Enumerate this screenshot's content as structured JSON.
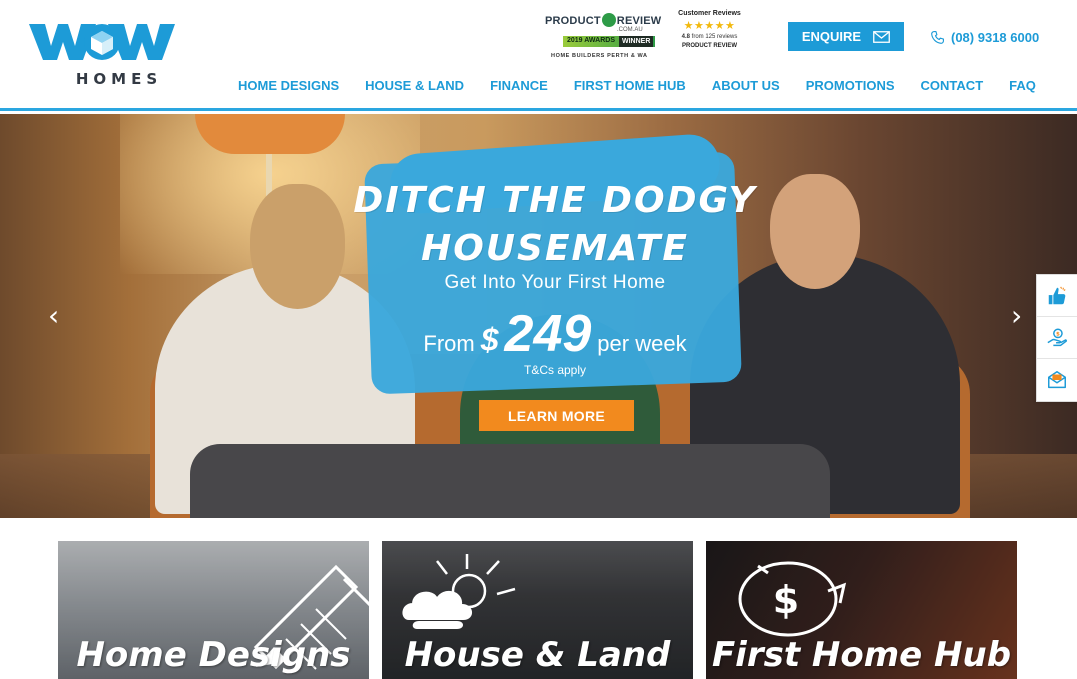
{
  "brand": {
    "logo_text": "WOW",
    "logo_subtext": "HOMES",
    "accent": "#1d9bd7",
    "orange": "#f28a1e"
  },
  "awards": {
    "product_review": {
      "title_left": "PRODUCT",
      "title_right": "REVIEW",
      "domain": ".COM.AU",
      "band_left": "2019 AWARDS",
      "band_right": "WINNER",
      "footer": "HOME BUILDERS PERTH & WA"
    },
    "customer_reviews": {
      "title": "Customer Reviews",
      "stars": "★★★★★",
      "rating": "4.8",
      "rating_suffix": "from 125 reviews",
      "footer": "PRODUCT REVIEW"
    }
  },
  "header": {
    "enquire_label": "ENQUIRE",
    "phone": "(08) 9318 6000"
  },
  "nav": {
    "items": [
      {
        "label": "HOME DESIGNS"
      },
      {
        "label": "HOUSE & LAND"
      },
      {
        "label": "FINANCE"
      },
      {
        "label": "FIRST HOME HUB"
      },
      {
        "label": "ABOUT US"
      },
      {
        "label": "PROMOTIONS"
      },
      {
        "label": "CONTACT"
      },
      {
        "label": "FAQ"
      }
    ]
  },
  "hero": {
    "headline_line1": "DITCH THE DODGY",
    "headline_line2": "HOUSEMATE",
    "subheadline": "Get Into Your First Home",
    "price_from": "From",
    "price_currency": "$",
    "price_amount": "249",
    "price_period": "per week",
    "terms": "T&Cs apply",
    "cta_label": "LEARN MORE",
    "prev_arrow": "‹",
    "next_arrow": "›"
  },
  "side_widget": {
    "icons": [
      "thumbs-up-icon",
      "hand-money-icon",
      "envelope-icon"
    ]
  },
  "tiles": [
    {
      "title": "Home Designs",
      "icon": "pencil-icon"
    },
    {
      "title": "House & Land",
      "icon": "cloud-sun-icon"
    },
    {
      "title": "First Home Hub",
      "icon": "piggy-bank-icon"
    }
  ]
}
